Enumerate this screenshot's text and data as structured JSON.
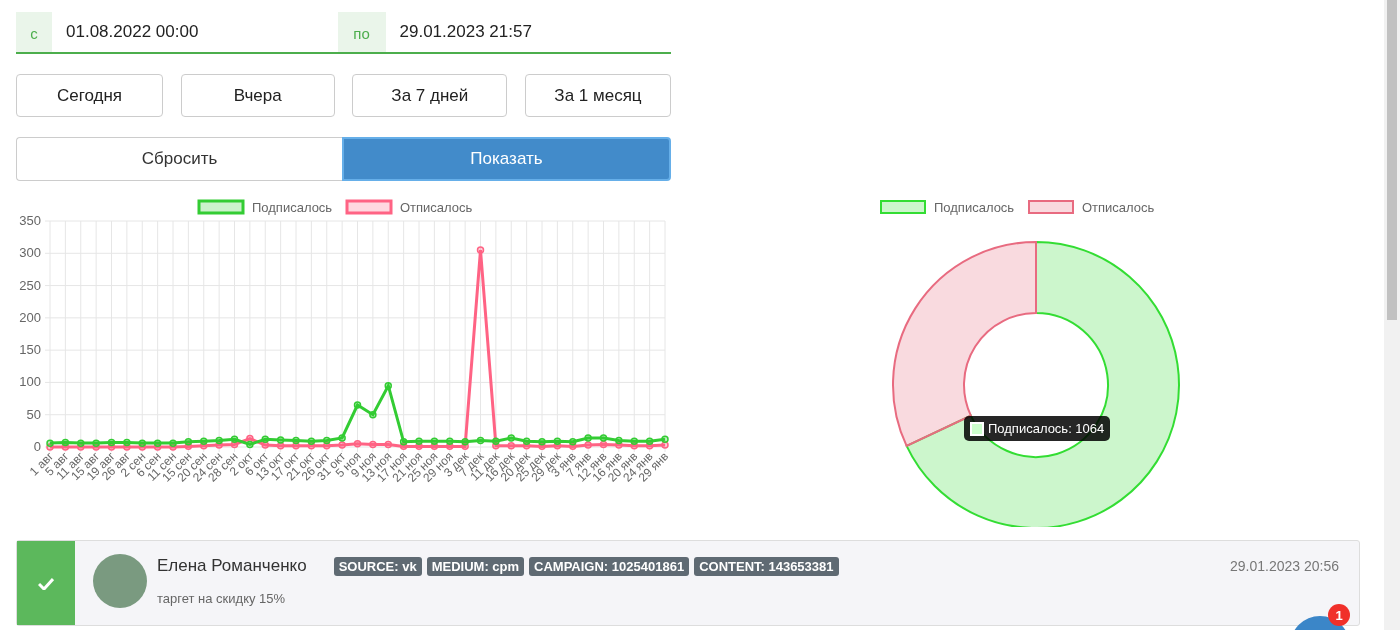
{
  "date_range": {
    "from_label": "с",
    "from_value": "01.08.2022 00:00",
    "to_label": "по",
    "to_value": "29.01.2023 21:57"
  },
  "quick_buttons": [
    "Сегодня",
    "Вчера",
    "За 7 дней",
    "За 1 месяц"
  ],
  "actions": [
    {
      "label": "Сбросить",
      "kind": "default"
    },
    {
      "label": "Показать",
      "kind": "primary"
    }
  ],
  "line_chart": {
    "chart_data": {
      "type": "line",
      "categories": [
        "1 авг",
        "5 авг",
        "11 авг",
        "15 авг",
        "19 авг",
        "26 авг",
        "2 сен",
        "6 сен",
        "11 сен",
        "15 сен",
        "20 сен",
        "24 сен",
        "28 сен",
        "2 окт",
        "6 окт",
        "13 окт",
        "17 окт",
        "21 окт",
        "26 окт",
        "31 окт",
        "5 ноя",
        "9 ноя",
        "13 ноя",
        "17 ноя",
        "21 ноя",
        "25 ноя",
        "29 ноя",
        "3 дек",
        "7 дек",
        "11 дек",
        "16 дек",
        "20 дек",
        "25 дек",
        "29 дек",
        "3 янв",
        "7 янв",
        "12 янв",
        "16 янв",
        "20 янв",
        "24 янв",
        "29 янв"
      ],
      "series": [
        {
          "name": "Подписалось",
          "color": "#33cc33",
          "marker": "circle",
          "values": [
            6,
            7,
            6,
            6,
            7,
            7,
            6,
            6,
            6,
            8,
            9,
            10,
            12,
            4,
            12,
            11,
            10,
            9,
            10,
            14,
            65,
            50,
            95,
            8,
            9,
            9,
            9,
            8,
            10,
            9,
            14,
            9,
            8,
            9,
            8,
            14,
            14,
            10,
            9,
            9,
            12
          ]
        },
        {
          "name": "Отписалось",
          "color": "#ff6384",
          "marker": "circle",
          "values": [
            0,
            0,
            0,
            0,
            0,
            0,
            0,
            0,
            0,
            1,
            2,
            3,
            4,
            13,
            3,
            2,
            2,
            2,
            2,
            3,
            5,
            4,
            4,
            1,
            1,
            1,
            1,
            1,
            305,
            2,
            2,
            2,
            1,
            2,
            1,
            3,
            4,
            3,
            2,
            2,
            3
          ]
        }
      ],
      "ylim": [
        0,
        350
      ],
      "yticks": [
        0,
        50,
        100,
        150,
        200,
        250,
        300,
        350
      ],
      "grid": true,
      "legend": true
    }
  },
  "donut_chart": {
    "chart_data": {
      "type": "donut",
      "categories": [
        "Подписалось",
        "Отписалось"
      ],
      "values": [
        68,
        32
      ],
      "colors": [
        "#33dd33",
        "#e86b80"
      ],
      "legend": true
    },
    "tooltip": "Подписалось: 1064"
  },
  "leads": [
    {
      "done": true,
      "name": "Елена Романченко",
      "tags": [
        "SOURCE: vk",
        "MEDIUM: cpm",
        "CAMPAIGN: 1025401861",
        "CONTENT: 143653381"
      ],
      "note": "таргет на скидку 15%",
      "date": "29.01.2023 20:56"
    }
  ],
  "chat_button": {
    "badge": "1"
  }
}
